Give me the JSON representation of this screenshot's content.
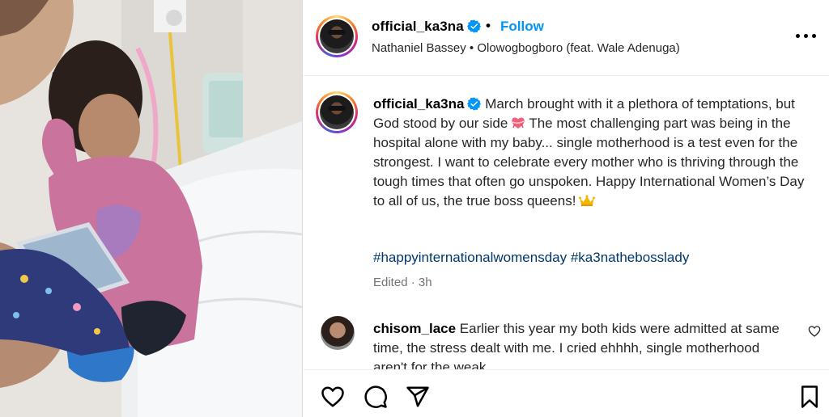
{
  "post": {
    "username": "official_ka3na",
    "follow_label": "Follow",
    "separator": "•",
    "audio": "Nathaniel Bassey • Olowogbogboro (feat. Wale Adenuga)",
    "caption_part1": "March brought with it a plethora of temptations, but God stood by our side",
    "caption_part2": "The most challenging part was being in the hospital alone with my baby... single motherhood is a test even for the strongest. I want to celebrate every mother who is thriving through the tough times that often go unspoken. Happy International Women’s Day to all of us, the true boss queens!",
    "hashtags": [
      "#happyinternationalwomensday",
      "#ka3natheboss­lady"
    ],
    "edited": "Edited · 3h",
    "emoji": [
      "heart-ribbon-emoji",
      "crown-emoji"
    ]
  },
  "comment": {
    "username": "chisom_lace",
    "text": "Earlier this year my both kids were admitted at same time, the stress dealt with me. I cried ehhhh, single motherhood aren't for the weak"
  },
  "icons": {
    "verified": "verified-badge-icon",
    "more": "more-options-icon",
    "like": "heart-icon",
    "comment": "comment-icon",
    "share": "share-icon",
    "save": "bookmark-icon"
  },
  "colors": {
    "follow": "#0095f6",
    "hashtag": "#00376b",
    "verified": "#0095f6",
    "muted": "#737373"
  }
}
